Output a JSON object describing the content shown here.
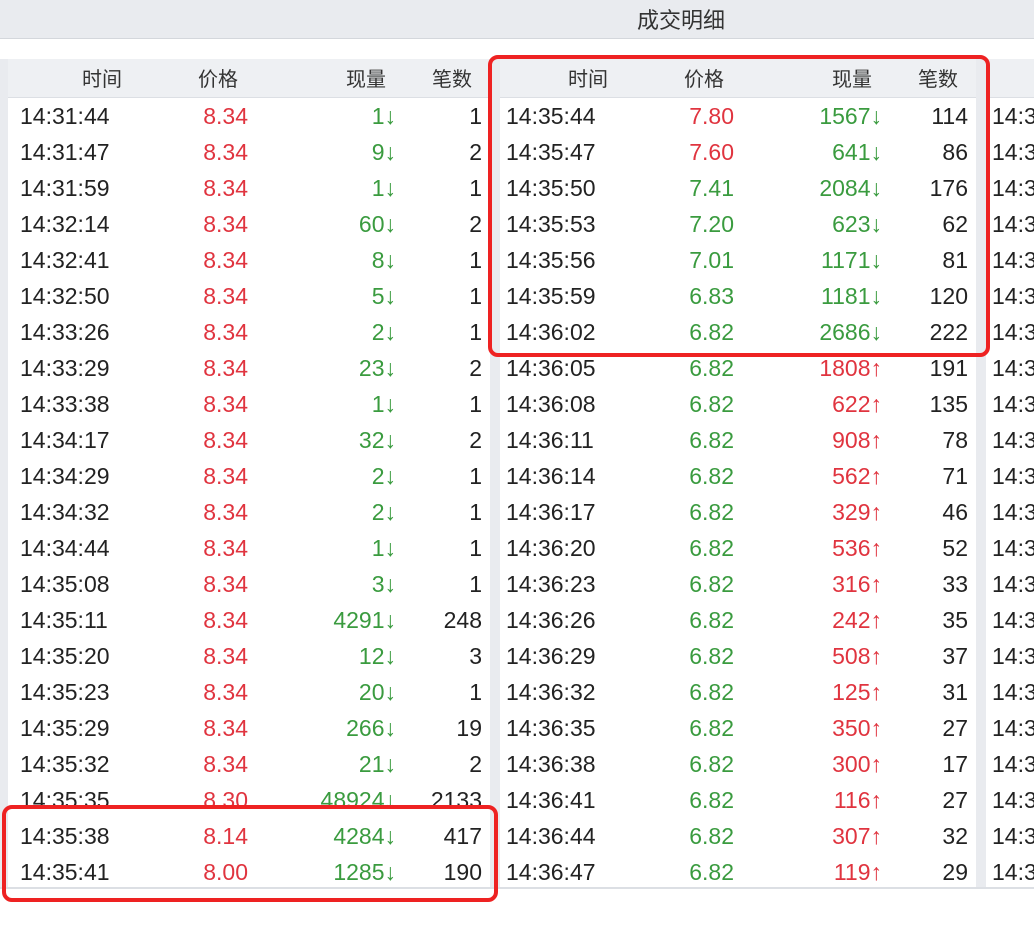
{
  "title": "成交明细",
  "headers": {
    "time": "时间",
    "price": "价格",
    "volume": "现量",
    "count": "笔数"
  },
  "colors": {
    "up": "#e0343f",
    "down": "#3a9b3f",
    "accent_highlight": "#ee2222"
  },
  "arrows": {
    "down": "↓",
    "up": "↑"
  },
  "panel1": {
    "rows": [
      {
        "time": "14:31:44",
        "price": "8.34",
        "price_dir": "up",
        "volume": "1",
        "dir": "down",
        "count": "1"
      },
      {
        "time": "14:31:47",
        "price": "8.34",
        "price_dir": "up",
        "volume": "9",
        "dir": "down",
        "count": "2"
      },
      {
        "time": "14:31:59",
        "price": "8.34",
        "price_dir": "up",
        "volume": "1",
        "dir": "down",
        "count": "1"
      },
      {
        "time": "14:32:14",
        "price": "8.34",
        "price_dir": "up",
        "volume": "60",
        "dir": "down",
        "count": "2"
      },
      {
        "time": "14:32:41",
        "price": "8.34",
        "price_dir": "up",
        "volume": "8",
        "dir": "down",
        "count": "1"
      },
      {
        "time": "14:32:50",
        "price": "8.34",
        "price_dir": "up",
        "volume": "5",
        "dir": "down",
        "count": "1"
      },
      {
        "time": "14:33:26",
        "price": "8.34",
        "price_dir": "up",
        "volume": "2",
        "dir": "down",
        "count": "1"
      },
      {
        "time": "14:33:29",
        "price": "8.34",
        "price_dir": "up",
        "volume": "23",
        "dir": "down",
        "count": "2"
      },
      {
        "time": "14:33:38",
        "price": "8.34",
        "price_dir": "up",
        "volume": "1",
        "dir": "down",
        "count": "1"
      },
      {
        "time": "14:34:17",
        "price": "8.34",
        "price_dir": "up",
        "volume": "32",
        "dir": "down",
        "count": "2"
      },
      {
        "time": "14:34:29",
        "price": "8.34",
        "price_dir": "up",
        "volume": "2",
        "dir": "down",
        "count": "1"
      },
      {
        "time": "14:34:32",
        "price": "8.34",
        "price_dir": "up",
        "volume": "2",
        "dir": "down",
        "count": "1"
      },
      {
        "time": "14:34:44",
        "price": "8.34",
        "price_dir": "up",
        "volume": "1",
        "dir": "down",
        "count": "1"
      },
      {
        "time": "14:35:08",
        "price": "8.34",
        "price_dir": "up",
        "volume": "3",
        "dir": "down",
        "count": "1"
      },
      {
        "time": "14:35:11",
        "price": "8.34",
        "price_dir": "up",
        "volume": "4291",
        "dir": "down",
        "count": "248"
      },
      {
        "time": "14:35:20",
        "price": "8.34",
        "price_dir": "up",
        "volume": "12",
        "dir": "down",
        "count": "3"
      },
      {
        "time": "14:35:23",
        "price": "8.34",
        "price_dir": "up",
        "volume": "20",
        "dir": "down",
        "count": "1"
      },
      {
        "time": "14:35:29",
        "price": "8.34",
        "price_dir": "up",
        "volume": "266",
        "dir": "down",
        "count": "19"
      },
      {
        "time": "14:35:32",
        "price": "8.34",
        "price_dir": "up",
        "volume": "21",
        "dir": "down",
        "count": "2"
      },
      {
        "time": "14:35:35",
        "price": "8.30",
        "price_dir": "up",
        "volume": "48924",
        "dir": "down",
        "count": "2133"
      },
      {
        "time": "14:35:38",
        "price": "8.14",
        "price_dir": "up",
        "volume": "4284",
        "dir": "down",
        "count": "417"
      },
      {
        "time": "14:35:41",
        "price": "8.00",
        "price_dir": "up",
        "volume": "1285",
        "dir": "down",
        "count": "190"
      }
    ]
  },
  "panel2": {
    "rows": [
      {
        "time": "14:35:44",
        "price": "7.80",
        "price_dir": "up",
        "volume": "1567",
        "dir": "down",
        "count": "114"
      },
      {
        "time": "14:35:47",
        "price": "7.60",
        "price_dir": "up",
        "volume": "641",
        "dir": "down",
        "count": "86"
      },
      {
        "time": "14:35:50",
        "price": "7.41",
        "price_dir": "down",
        "volume": "2084",
        "dir": "down",
        "count": "176"
      },
      {
        "time": "14:35:53",
        "price": "7.20",
        "price_dir": "down",
        "volume": "623",
        "dir": "down",
        "count": "62"
      },
      {
        "time": "14:35:56",
        "price": "7.01",
        "price_dir": "down",
        "volume": "1171",
        "dir": "down",
        "count": "81"
      },
      {
        "time": "14:35:59",
        "price": "6.83",
        "price_dir": "down",
        "volume": "1181",
        "dir": "down",
        "count": "120"
      },
      {
        "time": "14:36:02",
        "price": "6.82",
        "price_dir": "down",
        "volume": "2686",
        "dir": "down",
        "count": "222"
      },
      {
        "time": "14:36:05",
        "price": "6.82",
        "price_dir": "down",
        "volume": "1808",
        "dir": "up",
        "count": "191"
      },
      {
        "time": "14:36:08",
        "price": "6.82",
        "price_dir": "down",
        "volume": "622",
        "dir": "up",
        "count": "135"
      },
      {
        "time": "14:36:11",
        "price": "6.82",
        "price_dir": "down",
        "volume": "908",
        "dir": "up",
        "count": "78"
      },
      {
        "time": "14:36:14",
        "price": "6.82",
        "price_dir": "down",
        "volume": "562",
        "dir": "up",
        "count": "71"
      },
      {
        "time": "14:36:17",
        "price": "6.82",
        "price_dir": "down",
        "volume": "329",
        "dir": "up",
        "count": "46"
      },
      {
        "time": "14:36:20",
        "price": "6.82",
        "price_dir": "down",
        "volume": "536",
        "dir": "up",
        "count": "52"
      },
      {
        "time": "14:36:23",
        "price": "6.82",
        "price_dir": "down",
        "volume": "316",
        "dir": "up",
        "count": "33"
      },
      {
        "time": "14:36:26",
        "price": "6.82",
        "price_dir": "down",
        "volume": "242",
        "dir": "up",
        "count": "35"
      },
      {
        "time": "14:36:29",
        "price": "6.82",
        "price_dir": "down",
        "volume": "508",
        "dir": "up",
        "count": "37"
      },
      {
        "time": "14:36:32",
        "price": "6.82",
        "price_dir": "down",
        "volume": "125",
        "dir": "up",
        "count": "31"
      },
      {
        "time": "14:36:35",
        "price": "6.82",
        "price_dir": "down",
        "volume": "350",
        "dir": "up",
        "count": "27"
      },
      {
        "time": "14:36:38",
        "price": "6.82",
        "price_dir": "down",
        "volume": "300",
        "dir": "up",
        "count": "17"
      },
      {
        "time": "14:36:41",
        "price": "6.82",
        "price_dir": "down",
        "volume": "116",
        "dir": "up",
        "count": "27"
      },
      {
        "time": "14:36:44",
        "price": "6.82",
        "price_dir": "down",
        "volume": "307",
        "dir": "up",
        "count": "32"
      },
      {
        "time": "14:36:47",
        "price": "6.82",
        "price_dir": "down",
        "volume": "119",
        "dir": "up",
        "count": "29"
      }
    ]
  },
  "panel3_partial": "14:3"
}
